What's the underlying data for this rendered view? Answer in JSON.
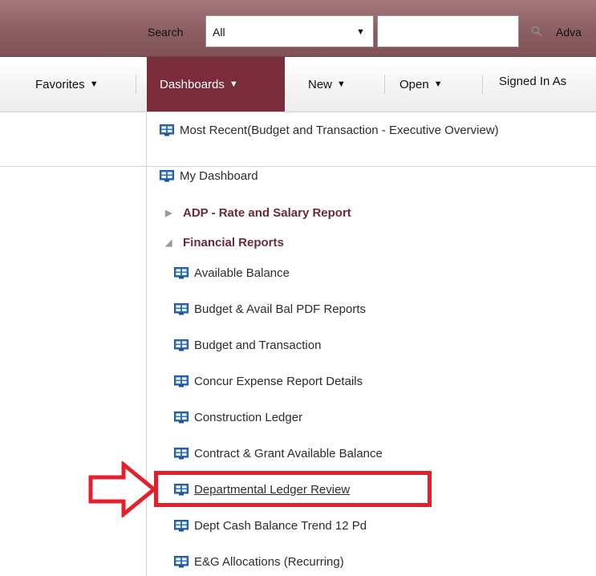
{
  "header": {
    "search_label": "Search",
    "search_scope": "All",
    "search_query": "",
    "advanced_label": "Adva"
  },
  "nav": {
    "favorites": "Favorites",
    "dashboards": "Dashboards",
    "new": "New",
    "open": "Open",
    "signed_in": "Signed In As"
  },
  "menu": {
    "most_recent": "Most Recent(Budget and Transaction - Executive Overview)",
    "my_dashboard": "My Dashboard",
    "folders": [
      {
        "label": "ADP - Rate and Salary Report",
        "expanded": false
      },
      {
        "label": "Financial Reports",
        "expanded": true
      }
    ],
    "financial_items": [
      "Available Balance",
      "Budget & Avail Bal PDF Reports",
      "Budget and Transaction",
      "Concur Expense Report Details",
      "Construction Ledger",
      "Contract & Grant Available Balance",
      "Departmental Ledger Review",
      "Dept Cash Balance Trend 12 Pd",
      "E&G Allocations (Recurring)"
    ],
    "highlighted_item": "Departmental Ledger Review"
  },
  "colors": {
    "topbar": "#8b5e63",
    "active_tab": "#7a2c3a",
    "folder_text": "#6b2a35",
    "annotation_red": "#e3202b",
    "icon_blue": "#2a6fc9"
  },
  "icons": {
    "dashboard": "dashboard-icon",
    "search": "magnifier-icon",
    "collapsed": "triangle-right-icon",
    "expanded": "triangle-down-icon",
    "annotation": "red-arrow"
  }
}
